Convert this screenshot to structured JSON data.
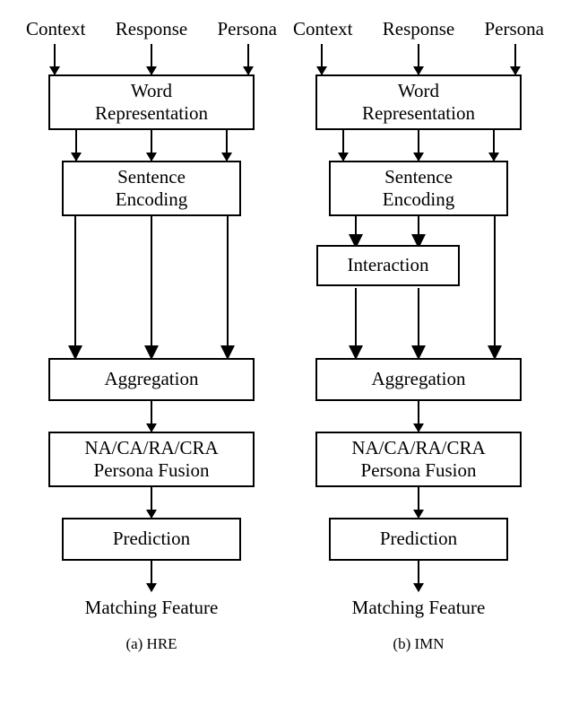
{
  "diagrams": [
    {
      "id": "hre",
      "inputs": [
        "Context",
        "Response",
        "Persona"
      ],
      "boxes": {
        "word": [
          "Word",
          "Representation"
        ],
        "sent": [
          "Sentence",
          "Encoding"
        ],
        "aggr": "Aggregation",
        "fusion": [
          "NA/CA/RA/CRA",
          "Persona Fusion"
        ],
        "pred": "Prediction"
      },
      "interaction": null,
      "output": "Matching Feature",
      "caption": "(a) HRE"
    },
    {
      "id": "imn",
      "inputs": [
        "Context",
        "Response",
        "Persona"
      ],
      "boxes": {
        "word": [
          "Word",
          "Representation"
        ],
        "sent": [
          "Sentence",
          "Encoding"
        ],
        "aggr": "Aggregation",
        "fusion": [
          "NA/CA/RA/CRA",
          "Persona Fusion"
        ],
        "pred": "Prediction"
      },
      "interaction": "Interaction",
      "output": "Matching Feature",
      "caption": "(b) IMN"
    }
  ],
  "chart_data": {
    "type": "diagram",
    "description": "Two parallel neural architecture flowcharts (HRE and IMN) for persona-based response matching.",
    "nodes_common": [
      "Context",
      "Response",
      "Persona",
      "Word Representation",
      "Sentence Encoding",
      "Aggregation",
      "NA/CA/RA/CRA Persona Fusion",
      "Prediction",
      "Matching Feature"
    ],
    "hre_path": [
      "Inputs",
      "Word Representation",
      "Sentence Encoding",
      "Aggregation",
      "Persona Fusion",
      "Prediction",
      "Matching Feature"
    ],
    "imn_extra_node": "Interaction",
    "imn_path": [
      "Inputs",
      "Word Representation",
      "Sentence Encoding",
      "Interaction (two of three streams)",
      "Aggregation",
      "Persona Fusion",
      "Prediction",
      "Matching Feature"
    ],
    "imn_bypass": "Third stream bypasses Interaction and goes directly from Sentence Encoding to Aggregation"
  }
}
